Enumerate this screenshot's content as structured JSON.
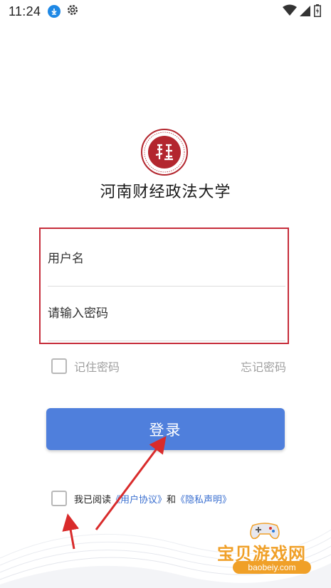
{
  "status_bar": {
    "time": "11:24",
    "icons": [
      "download-icon",
      "settings-icon",
      "wifi-icon",
      "signal-icon",
      "battery-charging-icon"
    ]
  },
  "logo": {
    "icon": "university-seal-icon",
    "color": "#b3262e"
  },
  "university_name": "河南财经政法大学",
  "form": {
    "username_placeholder": "用户名",
    "password_placeholder": "请输入密码",
    "highlight_color": "#c62d3a"
  },
  "options": {
    "remember_label": "记住密码",
    "forgot_label": "忘记密码"
  },
  "login_button": {
    "label": "登录",
    "color": "#4f7fdc"
  },
  "agreement": {
    "prefix": "我已阅读",
    "user_agreement": "《用户协议》",
    "and": "和",
    "privacy": "《隐私声明》",
    "link_color": "#3a6fd0"
  },
  "watermark": {
    "title": "宝贝游戏网",
    "url": "baobeiy.com",
    "icon": "gamepad-icon"
  }
}
